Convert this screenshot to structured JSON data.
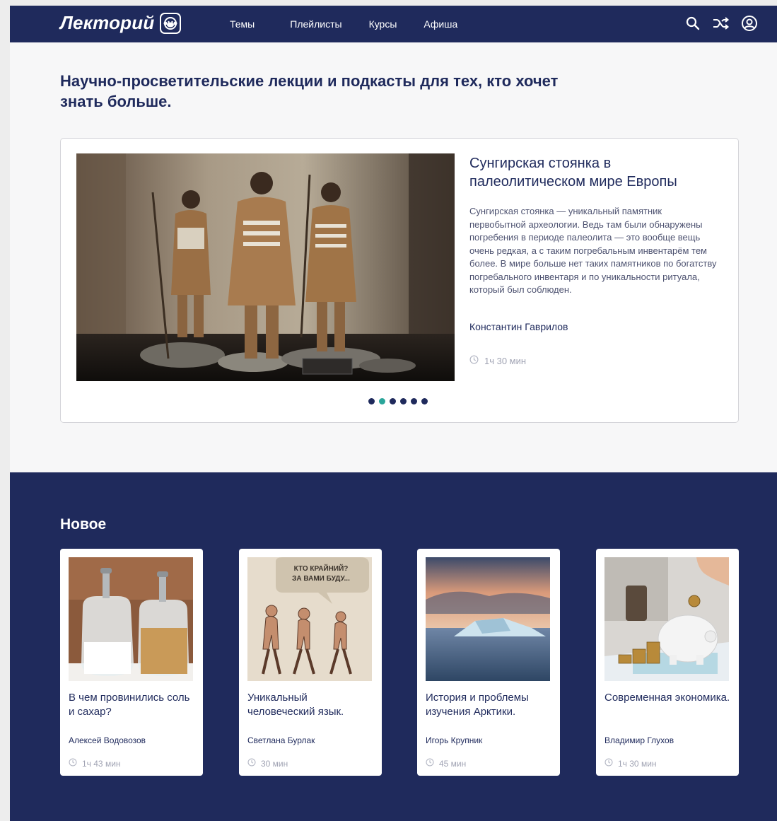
{
  "nav": {
    "logo_text": "Лекторий",
    "links": [
      "Темы",
      "Плейлисты",
      "Курсы",
      "Афиша"
    ],
    "icons": [
      "search-icon",
      "shuffle-icon",
      "user-icon"
    ]
  },
  "headline": "Научно-просветительские лекции и подкасты для тех, кто хочет знать больше.",
  "hero": {
    "title": "Сунгирская стоянка в палеолитическом мире Европы",
    "description": "Сунгирская стоянка — уникальный памятник первобытной археологии. Ведь там были обнаружены погребения в периоде палеолита — это вообще вещь очень редкая, а с таким погребальным инвентарём тем более. В мире больше нет таких памятников по богатству погребального инвентаря и по уникальности ритуала, который был соблюден.",
    "author": "Константин Гаврилов",
    "duration": "1ч 30 мин",
    "slides_count": 6,
    "active_slide": 2
  },
  "new_section": {
    "title": "Новое",
    "cards": [
      {
        "title": "В чем провинились соль и сахар?",
        "author": "Алексей Водовозов",
        "duration": "1ч 43 мин"
      },
      {
        "title": "Уникальный человеческий язык.",
        "author": "Светлана Бурлак",
        "duration": "30 мин",
        "image_caption_1": "КТО КРАЙНИЙ?",
        "image_caption_2": "ЗА ВАМИ БУДУ..."
      },
      {
        "title": "История и проблемы изучения Арктики.",
        "author": "Игорь Крупник",
        "duration": "45 мин"
      },
      {
        "title": "Современная экономика.",
        "author": "Владимир Глухов",
        "duration": "1ч 30 мин"
      }
    ]
  },
  "colors": {
    "navy": "#1f2a5c",
    "teal_accent": "#2aa59a",
    "muted": "#a0a3b3"
  }
}
